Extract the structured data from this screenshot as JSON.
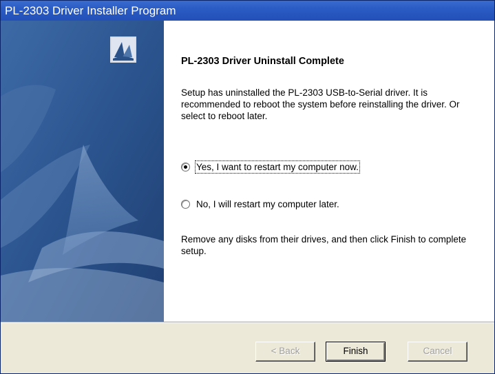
{
  "window": {
    "title": "PL-2303 Driver Installer Program"
  },
  "content": {
    "heading": "PL-2303 Driver Uninstall Complete",
    "description": "Setup has uninstalled the PL-2303 USB-to-Serial driver. It is recommended to reboot the system before reinstalling the driver. Or select to reboot later.",
    "options": [
      {
        "label": "Yes, I want to restart my computer now.",
        "selected": true
      },
      {
        "label": "No, I will restart my computer later.",
        "selected": false
      }
    ],
    "instructions": "Remove any disks from their drives, and then click Finish to complete setup."
  },
  "buttons": {
    "back": {
      "label": "< Back",
      "enabled": false
    },
    "finish": {
      "label": "Finish",
      "enabled": true
    },
    "cancel": {
      "label": "Cancel",
      "enabled": false
    }
  },
  "colors": {
    "titlebar": "#2a5bc4",
    "side_panel": "#2a5289",
    "dialog_face": "#ece9d8"
  },
  "icons": {
    "side_logo": "wizard-logo-icon"
  }
}
